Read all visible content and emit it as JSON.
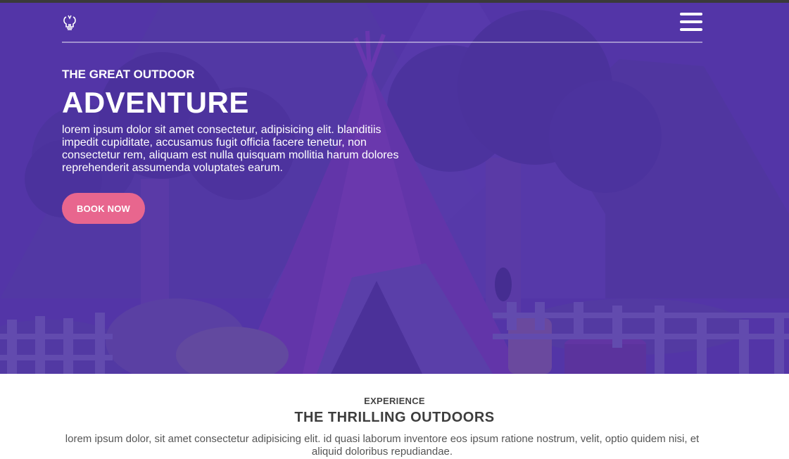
{
  "nav": {
    "logo_icon": "lightbulb-logo-icon",
    "menu_icon": "hamburger-menu-icon"
  },
  "hero": {
    "eyebrow": "THE GREAT OUTDOOR",
    "headline": "ADVENTURE",
    "intro": "lorem ipsum dolor sit amet consectetur, adipisicing elit. blanditiis impedit cupiditate, accusamus fugit officia facere tenetur, non consectetur rem, aliquam est nulla quisquam mollitia harum dolores reprehenderit assumenda voluptates earum.",
    "cta_label": "BOOK NOW",
    "illustration": "camping-tent-forest-illustration"
  },
  "experience": {
    "eyebrow": "EXPERIENCE",
    "title": "THE THRILLING OUTDOORS",
    "text": "lorem ipsum dolor, sit amet consectetur adipisicing elit. id quasi laborum inventore eos ipsum ratione nostrum, velit, optio quidem nisi, et aliquid doloribus repudiandae."
  },
  "colors": {
    "hero_overlay": "#4c2ea0",
    "cta_background": "#e8668e",
    "text_light": "#ffffff",
    "text_dark": "#444444"
  }
}
